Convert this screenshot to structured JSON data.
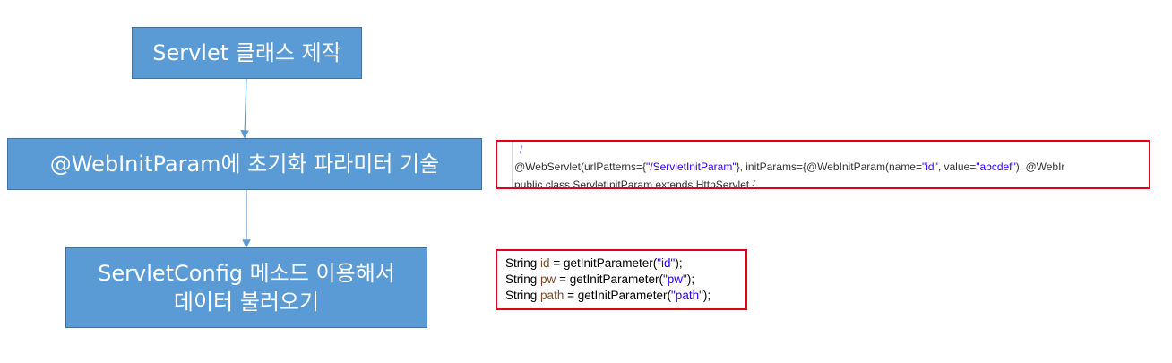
{
  "flow": {
    "step1": "Servlet 클래스 제작",
    "step2": "@WebInitParam에 초기화 파라미터 기술",
    "step3_line1": "ServletConfig 메소드 이용해서",
    "step3_line2": "데이터 불러오기"
  },
  "annotation_snippet": {
    "top_mark": "/",
    "prefix": "@WebServlet(urlPatterns={",
    "url": "\"/ServletInitParam\"",
    "mid1": "}, initParams={@WebInitParam(name=",
    "name_val": "\"id\"",
    "mid2": ", value=",
    "value_val": "\"abcdef\"",
    "tail": "), @WebIr",
    "cut_line": "public class ServletInitParam extends HttpServlet {"
  },
  "getter_snippet": {
    "lines": [
      {
        "type": "String",
        "var": "id",
        "assign": " = getInitParameter(",
        "arg": "\"id\"",
        "end": ");"
      },
      {
        "type": "String",
        "var": "pw",
        "assign": " = getInitParameter(",
        "arg": "\"pw\"",
        "end": ");"
      },
      {
        "type": "String",
        "var": "path",
        "assign": " = getInitParameter(",
        "arg": "\"path\"",
        "end": ");"
      }
    ]
  },
  "colors": {
    "box_fill": "#5b9bd5",
    "box_border": "#41719c",
    "arrow": "#5b9bd5",
    "highlight_border": "#e0001a",
    "string_literal": "#2a00ff",
    "variable": "#7a4a2a"
  }
}
